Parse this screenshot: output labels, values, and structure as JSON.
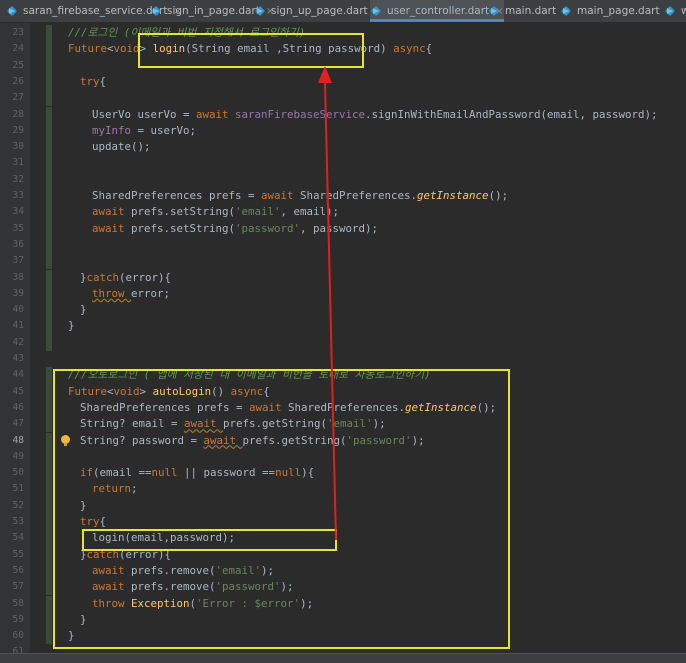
{
  "tabs": [
    {
      "label": "saran_firebase_service.dart",
      "close": "×",
      "active": false
    },
    {
      "label": "sign_in_page.dart",
      "close": "×",
      "active": false
    },
    {
      "label": "sign_up_page.dart",
      "close": "×",
      "active": false
    },
    {
      "label": "user_controller.dart",
      "close": "×",
      "active": true
    },
    {
      "label": "main.dart",
      "close": "×",
      "active": false
    },
    {
      "label": "main_page.dart",
      "close": "×",
      "active": false
    },
    {
      "label": "wr",
      "close": "",
      "active": false
    }
  ],
  "editor": {
    "lines": [
      {
        "n": "23",
        "t": [
          [
            "c",
            "///로그인 (이메일과 비번 지정해서 로그인하기)"
          ]
        ]
      },
      {
        "n": "24",
        "t": [
          [
            "k",
            "Future"
          ],
          [
            "",
            "<"
          ],
          [
            "k",
            "void"
          ],
          [
            "",
            "> "
          ],
          [
            "f",
            "login"
          ],
          [
            "",
            "(String email ,String password) "
          ],
          [
            "k",
            "async"
          ],
          [
            "",
            "{"
          ]
        ]
      },
      {
        "n": "25",
        "t": []
      },
      {
        "n": "26",
        "t": [
          [
            "k",
            "try"
          ],
          [
            "",
            "{"
          ]
        ]
      },
      {
        "n": "27",
        "t": []
      },
      {
        "n": "28",
        "t": [
          [
            "",
            "UserVo userVo = "
          ],
          [
            "k",
            "await "
          ],
          [
            "p",
            "saranFirebaseService"
          ],
          [
            "",
            ".signInWithEmailAndPassword(email, password);"
          ]
        ]
      },
      {
        "n": "29",
        "t": [
          [
            "p",
            "myInfo"
          ],
          [
            "",
            " = userVo;"
          ]
        ]
      },
      {
        "n": "30",
        "t": [
          [
            "",
            "update();"
          ]
        ]
      },
      {
        "n": "31",
        "t": []
      },
      {
        "n": "32",
        "t": []
      },
      {
        "n": "33",
        "t": [
          [
            "",
            "SharedPreferences prefs = "
          ],
          [
            "k",
            "await "
          ],
          [
            "",
            "SharedPreferences."
          ],
          [
            "it",
            "getInstance"
          ],
          [
            "",
            "();"
          ]
        ]
      },
      {
        "n": "34",
        "t": [
          [
            "k",
            "await "
          ],
          [
            "",
            "prefs.setString("
          ],
          [
            "s",
            "'email'"
          ],
          [
            "",
            ", email);"
          ]
        ]
      },
      {
        "n": "35",
        "t": [
          [
            "k",
            "await "
          ],
          [
            "",
            "prefs.setString("
          ],
          [
            "s",
            "'password'"
          ],
          [
            "",
            ", password);"
          ]
        ]
      },
      {
        "n": "36",
        "t": []
      },
      {
        "n": "37",
        "t": []
      },
      {
        "n": "38",
        "t": [
          [
            "",
            "}"
          ],
          [
            "k",
            "catch"
          ],
          [
            "",
            "(error){"
          ]
        ]
      },
      {
        "n": "39",
        "t": [
          [
            "k",
            "throw "
          ],
          [
            "",
            "error;"
          ]
        ]
      },
      {
        "n": "40",
        "t": [
          [
            "",
            "}"
          ]
        ]
      },
      {
        "n": "41",
        "t": [
          [
            "",
            "}"
          ]
        ]
      },
      {
        "n": "42",
        "t": []
      },
      {
        "n": "43",
        "t": []
      },
      {
        "n": "44",
        "t": [
          [
            "c",
            "///오토로그인 ( 앱에 저장된 내 이메일과 비번을 토대로 자동로그인하기)"
          ]
        ]
      },
      {
        "n": "45",
        "t": [
          [
            "k",
            "Future"
          ],
          [
            "",
            "<"
          ],
          [
            "k",
            "void"
          ],
          [
            "",
            "> "
          ],
          [
            "f",
            "autoLogin"
          ],
          [
            "",
            "() "
          ],
          [
            "k",
            "async"
          ],
          [
            "",
            "{"
          ]
        ]
      },
      {
        "n": "46",
        "t": [
          [
            "",
            "SharedPreferences prefs = "
          ],
          [
            "k",
            "await "
          ],
          [
            "",
            "SharedPreferences."
          ],
          [
            "it",
            "getInstance"
          ],
          [
            "",
            "();"
          ]
        ]
      },
      {
        "n": "47",
        "t": [
          [
            "",
            "String? email = "
          ],
          [
            "k",
            "await "
          ],
          [
            "",
            "prefs.getString("
          ],
          [
            "s",
            "'email'"
          ],
          [
            "",
            ");"
          ]
        ]
      },
      {
        "n": "48",
        "t": [
          [
            "",
            "String? password = "
          ],
          [
            "k",
            "await "
          ],
          [
            "",
            "prefs.getString("
          ],
          [
            "s",
            "'password'"
          ],
          [
            "",
            ");"
          ]
        ]
      },
      {
        "n": "49",
        "t": []
      },
      {
        "n": "50",
        "t": [
          [
            "k",
            "if"
          ],
          [
            "",
            "(email =="
          ],
          [
            "k",
            "null "
          ],
          [
            "",
            "|| password =="
          ],
          [
            "k",
            "null"
          ],
          [
            "",
            "){"
          ]
        ]
      },
      {
        "n": "51",
        "t": [
          [
            "k",
            "return"
          ],
          [
            "",
            ";"
          ]
        ]
      },
      {
        "n": "52",
        "t": [
          [
            "",
            "}"
          ]
        ]
      },
      {
        "n": "53",
        "t": [
          [
            "k",
            "try"
          ],
          [
            "",
            "{"
          ]
        ]
      },
      {
        "n": "54",
        "t": [
          [
            "",
            "login(email,password);"
          ]
        ]
      },
      {
        "n": "55",
        "t": [
          [
            "",
            "}"
          ],
          [
            "k",
            "catch"
          ],
          [
            "",
            "(error){"
          ]
        ]
      },
      {
        "n": "56",
        "t": [
          [
            "k",
            "await "
          ],
          [
            "",
            "prefs.remove("
          ],
          [
            "s",
            "'email'"
          ],
          [
            "",
            ");"
          ]
        ]
      },
      {
        "n": "57",
        "t": [
          [
            "k",
            "await "
          ],
          [
            "",
            "prefs.remove("
          ],
          [
            "s",
            "'password'"
          ],
          [
            "",
            ");"
          ]
        ]
      },
      {
        "n": "58",
        "t": [
          [
            "k",
            "throw "
          ],
          [
            "f",
            "Exception"
          ],
          [
            "",
            "("
          ],
          [
            "s",
            "'Error : $error'"
          ],
          [
            "",
            ");"
          ]
        ]
      },
      {
        "n": "59",
        "t": [
          [
            "",
            "}"
          ]
        ]
      },
      {
        "n": "60",
        "t": [
          [
            "",
            "}"
          ]
        ]
      },
      {
        "n": "61",
        "t": []
      }
    ]
  },
  "colors": {
    "background": "#2b2b2b",
    "keyword": "#cc7832",
    "function": "#ffc66d",
    "string": "#6a8759",
    "comment": "#629755",
    "field": "#9876aa",
    "annotation_box": "#e8e42a",
    "arrow": "#e02020"
  }
}
